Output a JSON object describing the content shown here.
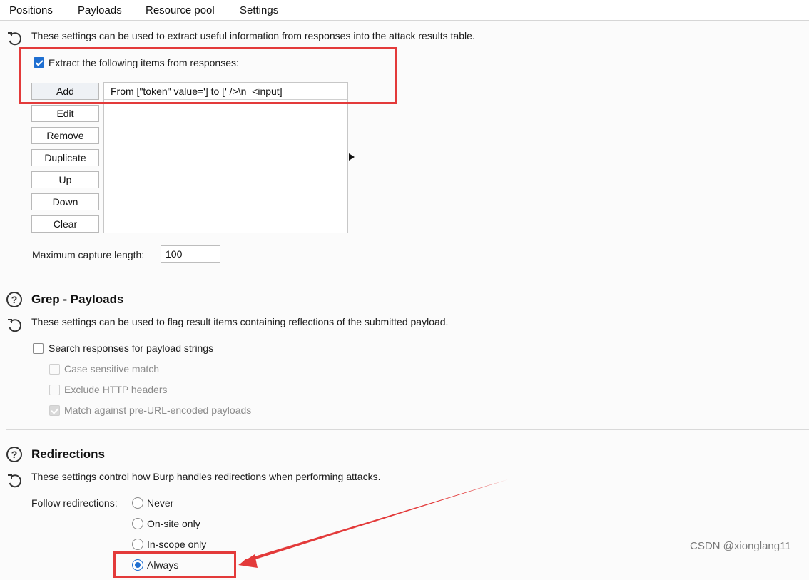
{
  "tabs": [
    {
      "label": "Positions",
      "active": false
    },
    {
      "label": "Payloads",
      "active": false
    },
    {
      "label": "Resource pool",
      "active": false
    },
    {
      "label": "Settings",
      "active": true
    }
  ],
  "grep_extract": {
    "description": "These settings can be used to extract useful information from responses into the attack results table.",
    "extract_checkbox": {
      "label": "Extract the following items from responses:",
      "checked": true
    },
    "buttons": {
      "add": "Add",
      "edit": "Edit",
      "remove": "Remove",
      "duplicate": "Duplicate",
      "up": "Up",
      "down": "Down",
      "clear": "Clear"
    },
    "items": [
      "From [\"token\" value='] to [' />\\n  <input]"
    ],
    "max_capture_label": "Maximum capture length:",
    "max_capture_value": "100"
  },
  "grep_payloads": {
    "title": "Grep - Payloads",
    "description": "These settings can be used to flag result items containing reflections of the submitted payload.",
    "search_checkbox": {
      "label": "Search responses for payload strings",
      "checked": false
    },
    "case_sensitive": {
      "label": "Case sensitive match",
      "checked": false,
      "enabled": false
    },
    "exclude_headers": {
      "label": "Exclude HTTP headers",
      "checked": false,
      "enabled": false
    },
    "match_pre_url": {
      "label": "Match against pre-URL-encoded payloads",
      "checked": true,
      "enabled": false
    }
  },
  "redirections": {
    "title": "Redirections",
    "description": "These settings control how Burp handles redirections when performing attacks.",
    "follow_label": "Follow redirections:",
    "options": [
      {
        "label": "Never",
        "selected": false
      },
      {
        "label": "On-site only",
        "selected": false
      },
      {
        "label": "In-scope only",
        "selected": false
      },
      {
        "label": "Always",
        "selected": true
      }
    ]
  },
  "watermark": "CSDN @xionglang11",
  "colors": {
    "accent": "#1f6fd1",
    "tab_underline": "#e8662e",
    "annotation_red": "#e33a3a"
  },
  "icons": {
    "help": "question-circle-icon",
    "reset": "reset-icon",
    "expand": "triangle-right-icon"
  }
}
